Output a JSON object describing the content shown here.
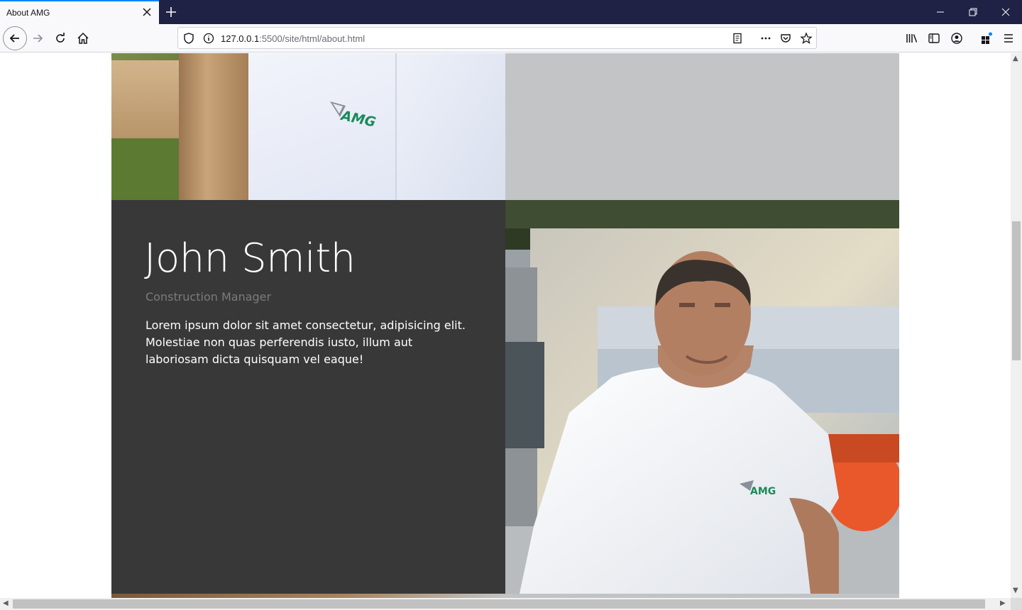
{
  "browser": {
    "tab_title": "About AMG",
    "url_host": "127.0.0.1",
    "url_path": ":5500/site/html/about.html"
  },
  "page": {
    "profile": {
      "name": "John Smith",
      "role": "Construction Manager",
      "bio": "Lorem ipsum dolor sit amet consectetur, adipisicing elit. Molestiae non quas perferendis iusto, illum aut laboriosam dicta quisquam vel eaque!"
    },
    "logo_text": "AMG"
  },
  "colors": {
    "tabbar": "#1f2245",
    "panel": "#383838",
    "grey_block": "#c3c4c6",
    "logo_green": "#1a8a5a"
  },
  "icons": {
    "back": "arrow-left-icon",
    "forward": "arrow-right-icon",
    "reload": "reload-icon",
    "home": "home-icon",
    "shield": "shield-icon",
    "info": "info-icon",
    "reader": "reader-view-icon",
    "more": "more-icon",
    "pocket": "pocket-icon",
    "bookmark": "star-icon",
    "library": "library-icon",
    "sidebar": "sidebar-icon",
    "account": "account-icon",
    "extensions": "extensions-icon",
    "menu": "hamburger-menu-icon"
  }
}
